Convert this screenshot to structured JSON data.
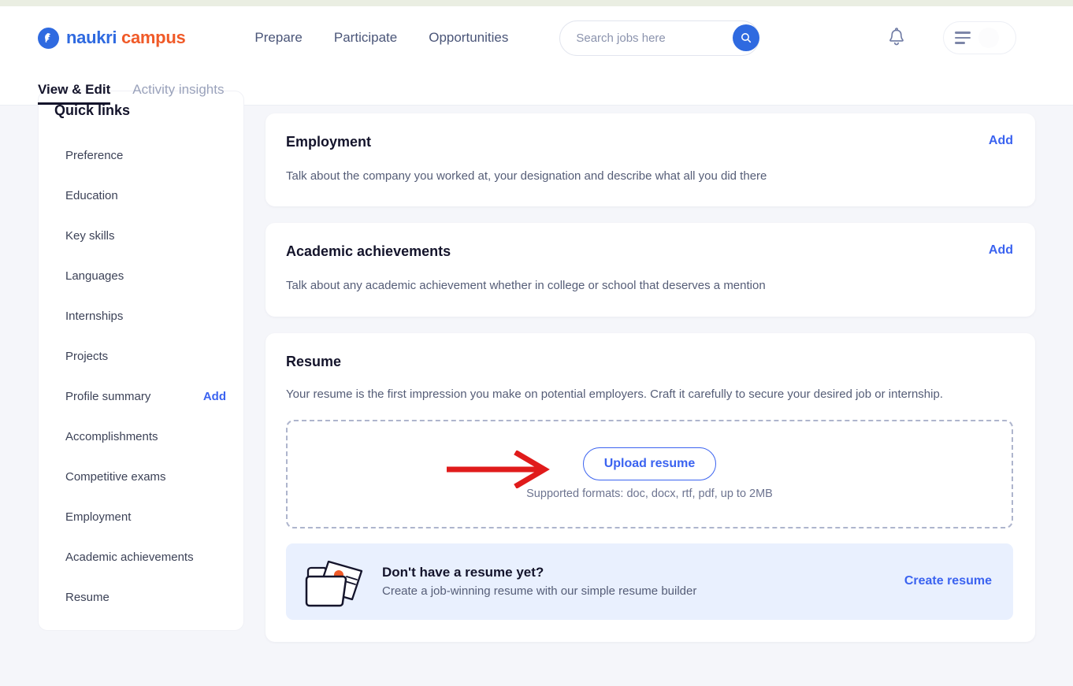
{
  "brand": {
    "name_first": "naukri",
    "name_second": "campus",
    "logo_icon": "naukri-bird-logo-icon",
    "primary_color": "#2f6ae0",
    "accent_color": "#f05a28"
  },
  "header": {
    "nav": [
      {
        "label": "Prepare"
      },
      {
        "label": "Participate"
      },
      {
        "label": "Opportunities"
      }
    ],
    "search": {
      "placeholder": "Search jobs here",
      "value": "",
      "icon": "search-icon"
    },
    "notifications_icon": "bell-icon",
    "menu_icon": "hamburger-icon",
    "avatar": "user-avatar"
  },
  "tabs": [
    {
      "label": "View & Edit",
      "active": true
    },
    {
      "label": "Activity insights",
      "active": false
    }
  ],
  "sidebar": {
    "title": "Quick links",
    "items": [
      {
        "label": "Preference"
      },
      {
        "label": "Education"
      },
      {
        "label": "Key skills"
      },
      {
        "label": "Languages"
      },
      {
        "label": "Internships"
      },
      {
        "label": "Projects"
      },
      {
        "label": "Profile summary",
        "action": "Add"
      },
      {
        "label": "Accomplishments"
      },
      {
        "label": "Competitive exams"
      },
      {
        "label": "Employment"
      },
      {
        "label": "Academic achievements"
      },
      {
        "label": "Resume"
      }
    ]
  },
  "main": {
    "cards": [
      {
        "title": "Employment",
        "action": "Add",
        "description": "Talk about the company you worked at, your designation and describe what all you did there"
      },
      {
        "title": "Academic achievements",
        "action": "Add",
        "description": "Talk about any academic achievement whether in college or school that deserves a mention"
      }
    ],
    "resume_card": {
      "title": "Resume",
      "description": "Your resume is the first impression you make on potential employers. Craft it carefully to secure your desired job or internship.",
      "upload_button": "Upload resume",
      "supported_formats": "Supported formats: doc, docx, rtf, pdf, up to 2MB",
      "annotation_arrow": {
        "icon": "red-arrow-annotation",
        "color": "#e01b1b",
        "points_to": "Upload resume"
      },
      "promo": {
        "illustration": "folder-document-icon",
        "title": "Don't have a resume yet?",
        "subtitle": "Create a job-winning resume with our simple resume builder",
        "cta": "Create resume",
        "background": "#e9f0fe"
      }
    }
  }
}
